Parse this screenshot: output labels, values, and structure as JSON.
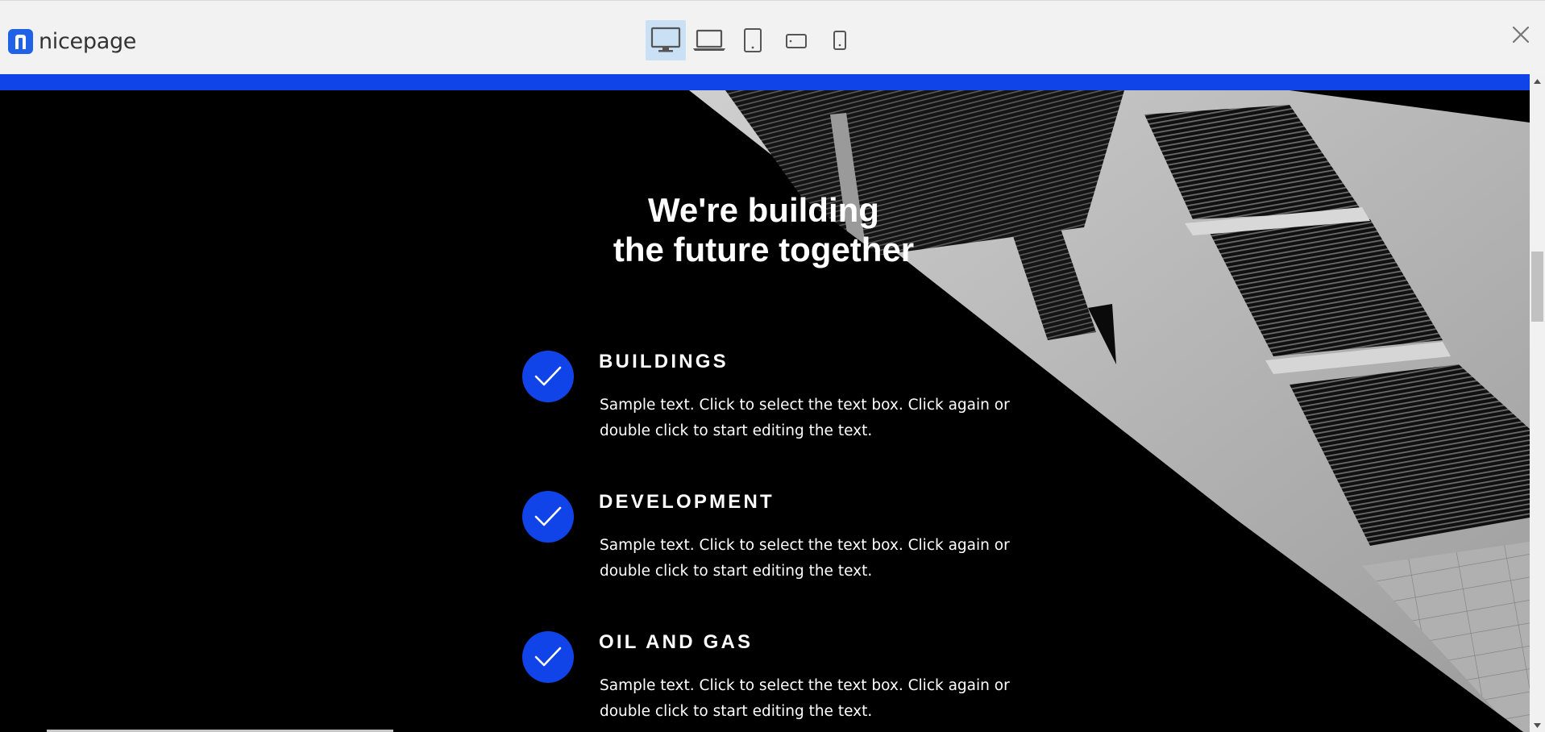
{
  "app": {
    "logo_text": "nicepage",
    "logo_icon": "nicepage-logo-icon"
  },
  "toolbar": {
    "devices": [
      {
        "icon": "desktop-icon",
        "active": true
      },
      {
        "icon": "laptop-icon",
        "active": false
      },
      {
        "icon": "tablet-portrait-icon",
        "active": false
      },
      {
        "icon": "tablet-landscape-icon",
        "active": false
      },
      {
        "icon": "phone-icon",
        "active": false
      }
    ],
    "close_icon": "close-icon"
  },
  "colors": {
    "accent": "#1043e8",
    "toolbar_bg": "#f2f2f2",
    "active_device_bg": "#c9e0f5",
    "hero_bg": "#000000"
  },
  "hero": {
    "title_line1": "We're building",
    "title_line2": "the future together",
    "features": [
      {
        "title": "BUILDINGS",
        "text": "Sample text. Click to select the text box. Click again or double click to start editing the text.",
        "icon": "check-icon"
      },
      {
        "title": "DEVELOPMENT",
        "text": "Sample text. Click to select the text box. Click again or double click to start editing the text.",
        "icon": "check-icon"
      },
      {
        "title": "OIL AND GAS",
        "text": "Sample text. Click to select the text box. Click again or double click to start editing the text.",
        "icon": "check-icon"
      }
    ]
  }
}
